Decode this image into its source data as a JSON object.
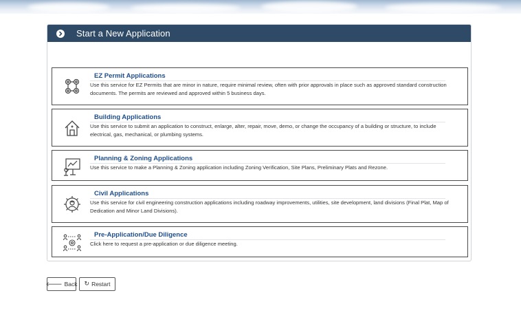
{
  "header": {
    "title": "Start a New Application"
  },
  "cards": [
    {
      "title": "EZ Permit Applications",
      "description": "Use this service for EZ Permits that are minor in nature, require minimal review, often with prior approvals in place such as approved standard construction documents. The permits are reviewed and approved within 5 business days.",
      "icon": "gears-icon"
    },
    {
      "title": "Building Applications",
      "description": "Use this service to submit an application to construct, enlarge, alter, repair, move, demo, or change the occupancy of a building or structure, to include electrical, gas, mechanical, or plumbing systems.",
      "icon": "house-icon"
    },
    {
      "title": "Planning & Zoning Applications",
      "description": "Use this service to make a Planning & Zoning application including Zoning Verification, Site Plans, Preliminary Plats and Rezone.",
      "icon": "presentation-icon"
    },
    {
      "title": "Civil Applications",
      "description": "Use this service for civil engineering construction applications including roadway improvements, utilities, site development, land divisions (Final Plat, Map of Dedication and Minor Land Divisions).",
      "icon": "engineer-gear-icon"
    },
    {
      "title": "Pre-Application/Due Diligence",
      "description": "Click here to request a pre-application or due diligence meeting.",
      "icon": "meeting-icon"
    }
  ],
  "footer": {
    "back_label": "Back",
    "restart_label": "Restart"
  }
}
